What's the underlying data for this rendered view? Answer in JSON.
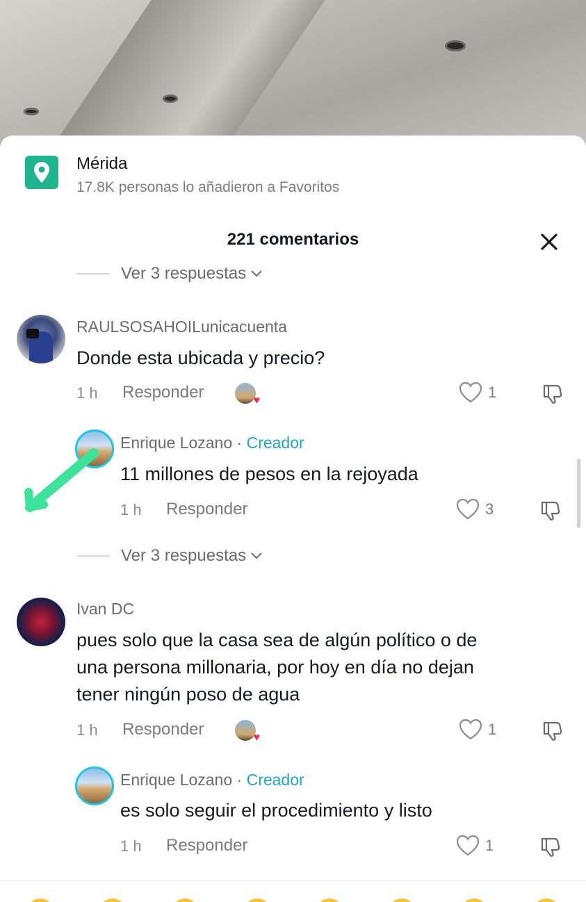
{
  "location": {
    "name": "Mérida",
    "subtitle": "17.8K personas lo añadieron a Favoritos"
  },
  "header": {
    "title": "221 comentarios"
  },
  "view_replies": [
    "Ver 3 respuestas",
    "Ver 3 respuestas"
  ],
  "comments": [
    {
      "user": "RAULSOSAHOILunicacuenta",
      "text": "Donde esta ubicada y precio?",
      "time": "1 h",
      "reply_label": "Responder",
      "likes": "1"
    },
    {
      "user": "Enrique Lozano",
      "separator": " · ",
      "badge": "Creador",
      "text": "11 millones de pesos en la rejoyada",
      "time": "1 h",
      "reply_label": "Responder",
      "likes": "3"
    },
    {
      "user": "Ivan DC",
      "text_lines": [
        "pues solo que la casa sea de algún político o de",
        "una persona millonaria, por hoy en día no dejan",
        "tener ningún poso de agua"
      ],
      "time": "1 h",
      "reply_label": "Responder",
      "likes": "1"
    },
    {
      "user": "Enrique Lozano",
      "separator": " · ",
      "badge": "Creador",
      "text": "es solo seguir el procedimiento y listo",
      "time": "1 h",
      "reply_label": "Responder",
      "likes": "1"
    }
  ],
  "colors": {
    "location_badge": "#1fb58f",
    "creator_badge": "#20a5c9",
    "annotation_arrow": "#3ee39a",
    "heart": "#fe2c55"
  },
  "icons": [
    "location-pin-icon",
    "close-icon",
    "chevron-down-icon",
    "heart-icon",
    "dislike-icon"
  ]
}
